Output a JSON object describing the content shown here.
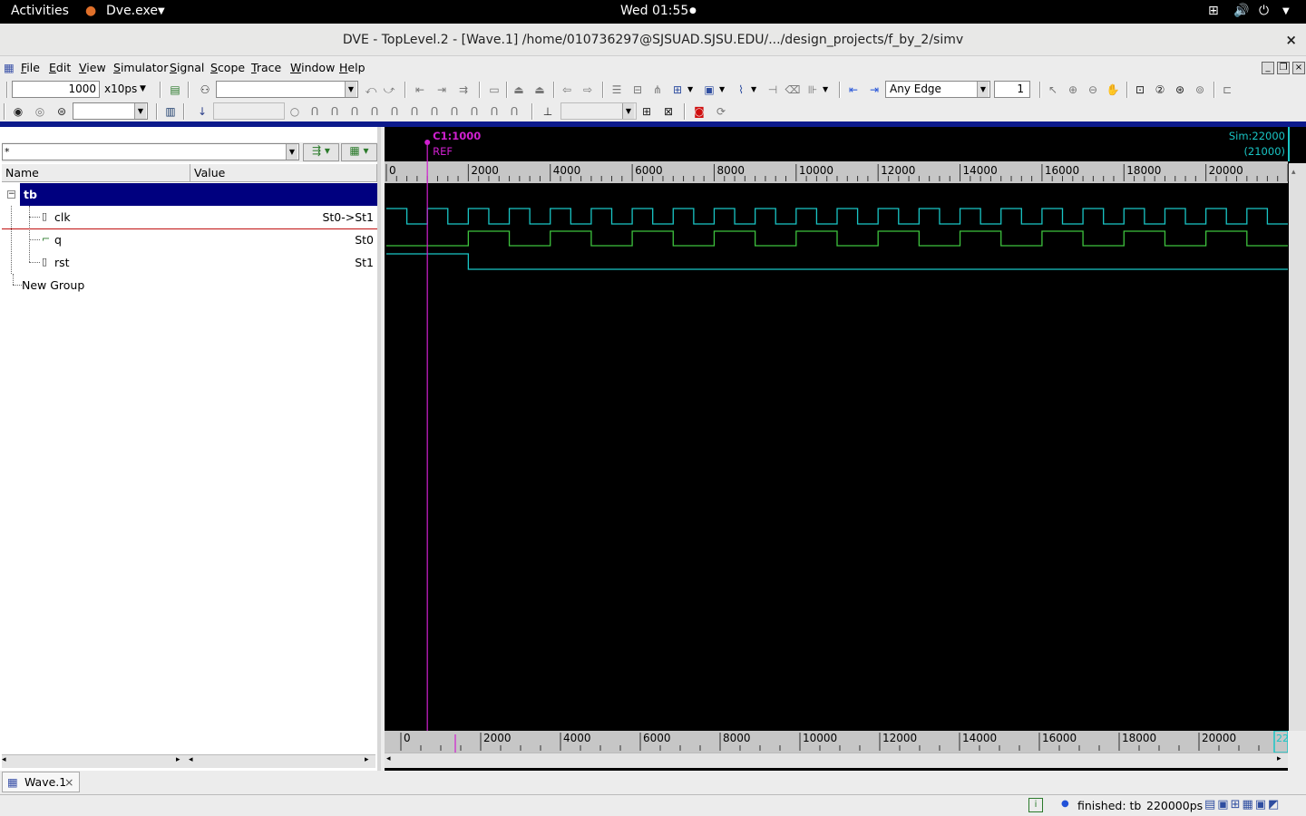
{
  "gnome": {
    "activities": "Activities",
    "app_name": "Dve.exe",
    "clock": "Wed 01:55"
  },
  "window": {
    "title": "DVE - TopLevel.2 - [Wave.1]  /home/010736297@SJSUAD.SJSU.EDU/.../design_projects/f_by_2/simv",
    "close": "×"
  },
  "menu": [
    {
      "label": "File",
      "u": "F",
      "rest": "ile"
    },
    {
      "label": "Edit",
      "u": "E",
      "rest": "dit"
    },
    {
      "label": "View",
      "u": "V",
      "rest": "iew"
    },
    {
      "label": "Simulator",
      "u": "S",
      "rest": "imulator"
    },
    {
      "label": "Signal",
      "u": "S",
      "rest": "ignal"
    },
    {
      "label": "Scope",
      "u": "S",
      "rest": "cope"
    },
    {
      "label": "Trace",
      "u": "T",
      "rest": "race"
    },
    {
      "label": "Window",
      "u": "W",
      "rest": "indow"
    },
    {
      "label": "Help",
      "u": "H",
      "rest": "elp"
    }
  ],
  "toolbar": {
    "time_value": "1000",
    "time_unit": "x10ps",
    "edge_select": "Any Edge",
    "edge_count": "1"
  },
  "signals_pane": {
    "filter_value": "*",
    "col_name": "Name",
    "col_value": "Value",
    "scope": "tb",
    "signals": [
      {
        "name": "clk",
        "value": "St0->St1",
        "icon": "bus-icon"
      },
      {
        "name": "q",
        "value": "St0",
        "icon": "wave-icon"
      },
      {
        "name": "rst",
        "value": "St1",
        "icon": "bus-icon"
      }
    ],
    "group": "New Group"
  },
  "wave": {
    "cursor_label": "C1:1000",
    "ref_label": "REF",
    "sim_label": "Sim:22000",
    "sim_sub": "(21000)",
    "ticks": [
      "0",
      "2000",
      "4000",
      "6000",
      "8000",
      "10000",
      "12000",
      "14000",
      "16000",
      "18000",
      "20000"
    ],
    "end_tick_label": "22",
    "range_start": 0,
    "range_end": 22000,
    "cursor_time": 1000,
    "clk_period": 1000,
    "q_period": 2000,
    "rst_release": 2000,
    "colors": {
      "clk": "#19c5c5",
      "q": "#3ec33e",
      "rst": "#19c5c5",
      "cursor": "#d020d0"
    }
  },
  "tabs": {
    "wave_tab": "Wave.1"
  },
  "status": {
    "finished": "finished: tb",
    "time": "220000ps"
  }
}
